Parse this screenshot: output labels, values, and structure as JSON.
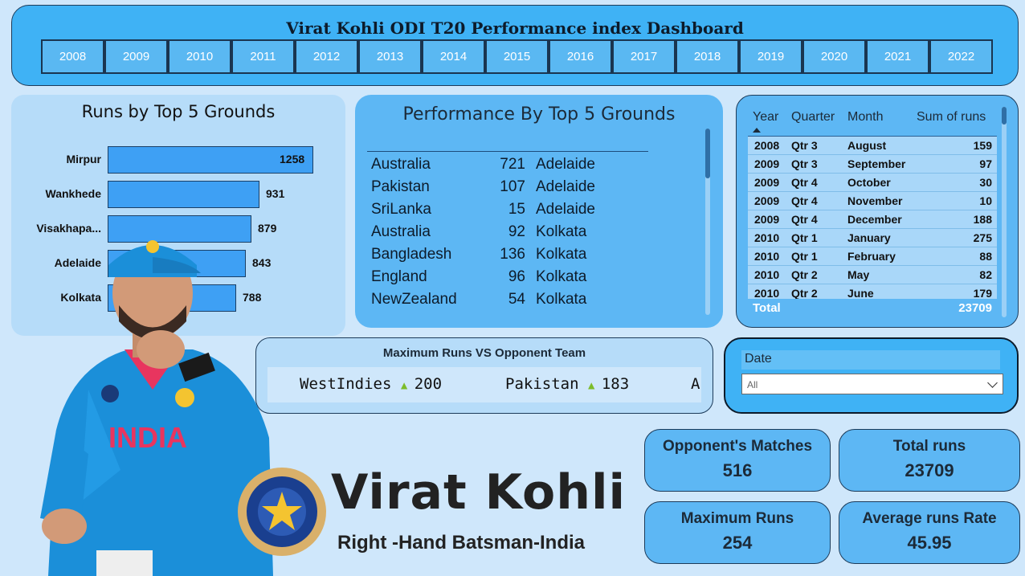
{
  "header": {
    "title": "Virat Kohli ODI T20 Performance index Dashboard",
    "years": [
      "2008",
      "2009",
      "2010",
      "2011",
      "2012",
      "2013",
      "2014",
      "2015",
      "2016",
      "2017",
      "2018",
      "2019",
      "2020",
      "2021",
      "2022"
    ]
  },
  "runs_by_grounds": {
    "title": "Runs by Top 5 Grounds",
    "bars": [
      {
        "label": "Mirpur",
        "value": "1258",
        "amount": 1258
      },
      {
        "label": "Wankhede",
        "value": "931",
        "amount": 931
      },
      {
        "label": "Visakhapa...",
        "value": "879",
        "amount": 879
      },
      {
        "label": "Adelaide",
        "value": "843",
        "amount": 843
      },
      {
        "label": "Kolkata",
        "value": "788",
        "amount": 788
      }
    ]
  },
  "performance": {
    "title": "Performance By Top 5 Grounds",
    "rows": [
      {
        "team": "Australia",
        "runs": "721",
        "ground": "Adelaide"
      },
      {
        "team": "Pakistan",
        "runs": "107",
        "ground": "Adelaide"
      },
      {
        "team": "SriLanka",
        "runs": "15",
        "ground": "Adelaide"
      },
      {
        "team": "Australia",
        "runs": "92",
        "ground": "Kolkata"
      },
      {
        "team": "Bangladesh",
        "runs": "136",
        "ground": "Kolkata"
      },
      {
        "team": "England",
        "runs": "96",
        "ground": "Kolkata"
      },
      {
        "team": "NewZealand",
        "runs": "54",
        "ground": "Kolkata"
      }
    ]
  },
  "runs_table": {
    "headers": {
      "year": "Year",
      "quarter": "Quarter",
      "month": "Month",
      "sum": "Sum of runs"
    },
    "rows": [
      {
        "year": "2008",
        "quarter": "Qtr 3",
        "month": "August",
        "sum": "159"
      },
      {
        "year": "2009",
        "quarter": "Qtr 3",
        "month": "September",
        "sum": "97"
      },
      {
        "year": "2009",
        "quarter": "Qtr 4",
        "month": "October",
        "sum": "30"
      },
      {
        "year": "2009",
        "quarter": "Qtr 4",
        "month": "November",
        "sum": "10"
      },
      {
        "year": "2009",
        "quarter": "Qtr 4",
        "month": "December",
        "sum": "188"
      },
      {
        "year": "2010",
        "quarter": "Qtr 1",
        "month": "January",
        "sum": "275"
      },
      {
        "year": "2010",
        "quarter": "Qtr 1",
        "month": "February",
        "sum": "88"
      },
      {
        "year": "2010",
        "quarter": "Qtr 2",
        "month": "May",
        "sum": "82"
      },
      {
        "year": "2010",
        "quarter": "Qtr 2",
        "month": "June",
        "sum": "179"
      }
    ],
    "total_label": "Total",
    "total_value": "23709"
  },
  "max_runs": {
    "title": "Maximum Runs VS Opponent Team",
    "items": [
      {
        "team": "WestIndies",
        "value": "200"
      },
      {
        "team": "Pakistan",
        "value": "183"
      },
      {
        "team": "A",
        "value": ""
      }
    ]
  },
  "date_slicer": {
    "label": "Date",
    "selected": "All"
  },
  "kpis": {
    "opponent_matches": {
      "label": "Opponent's Matches",
      "value": "516"
    },
    "total_runs": {
      "label": "Total runs",
      "value": "23709"
    },
    "maximum_runs": {
      "label": "Maximum Runs",
      "value": "254"
    },
    "average_rate": {
      "label": "Average runs Rate",
      "value": "45.95"
    }
  },
  "profile": {
    "name": "Virat Kohli",
    "role": "Right -Hand Batsman-India"
  },
  "colors": {
    "accent": "#3fb2f5",
    "bar": "#3ea0f4",
    "background": "#cfe7fb"
  }
}
